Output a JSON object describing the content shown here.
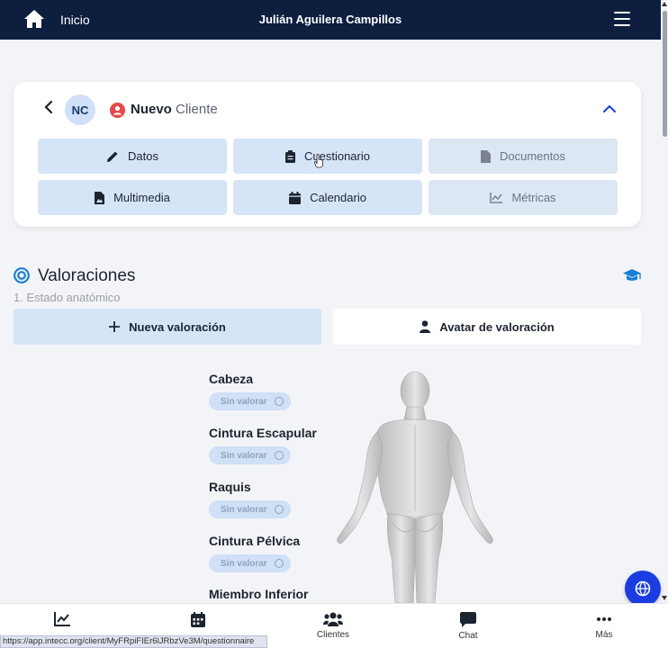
{
  "header": {
    "home_label": "Inicio",
    "user_name": "Julián Aguilera Campillos"
  },
  "client": {
    "initials": "NC",
    "title_bold": "Nuevo",
    "title_rest": "Cliente",
    "tiles": [
      {
        "label": "Datos",
        "icon": "pencil-icon",
        "enabled": true
      },
      {
        "label": "Cuestionario",
        "icon": "clipboard-icon",
        "enabled": true
      },
      {
        "label": "Documentos",
        "icon": "document-icon",
        "enabled": false
      },
      {
        "label": "Multimedia",
        "icon": "image-file-icon",
        "enabled": true
      },
      {
        "label": "Calendario",
        "icon": "calendar-icon",
        "enabled": true
      },
      {
        "label": "Métricas",
        "icon": "line-chart-icon",
        "enabled": false
      }
    ]
  },
  "valoraciones": {
    "title": "Valoraciones",
    "subtitle": "1. Estado anatómico",
    "new_button": "Nueva valoración",
    "avatar_button": "Avatar de valoración",
    "regions": [
      {
        "label": "Cabeza",
        "status": "Sin valorar"
      },
      {
        "label": "Cintura Escapular",
        "status": "Sin valorar"
      },
      {
        "label": "Raquis",
        "status": "Sin valorar"
      },
      {
        "label": "Cintura Pélvica",
        "status": "Sin valorar"
      },
      {
        "label": "Miembro Inferior",
        "status": ""
      }
    ]
  },
  "bottom_nav": [
    {
      "label": "",
      "icon": "line-chart-icon"
    },
    {
      "label": "",
      "icon": "calendar-icon"
    },
    {
      "label": "Clientes",
      "icon": "users-icon"
    },
    {
      "label": "Chat",
      "icon": "chat-icon"
    },
    {
      "label": "Más",
      "icon": "more-icon"
    }
  ],
  "status_bar_url": "https://app.intecc.org/client/MyFRpiFIEr6lJRbzVe3M/questionnaire",
  "colors": {
    "header_bg": "#0e1e3f",
    "tile_bg": "#d6e4f8",
    "accent_blue": "#1a3ce0",
    "badge_red": "#e34a4a"
  }
}
